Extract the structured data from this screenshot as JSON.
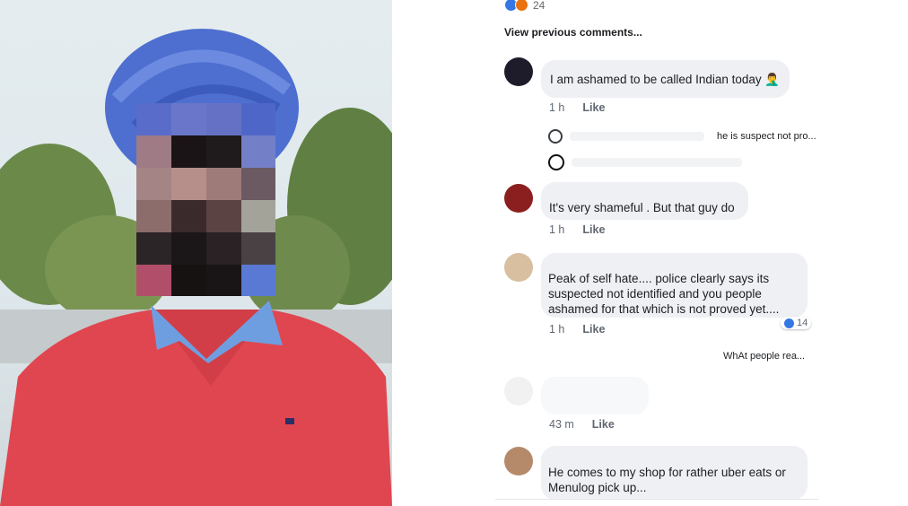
{
  "post": {
    "reaction_count": "24",
    "reaction_icons": [
      "like-icon",
      "angry-icon"
    ],
    "view_previous": "View previous comments..."
  },
  "comments": [
    {
      "text": "I am ashamed to be called Indian today 🤦‍♂️",
      "time": "1 h",
      "like": "Like",
      "replies": [
        {
          "text": "he is suspect not pro..."
        },
        {
          "text": ""
        }
      ]
    },
    {
      "text": "It's very shameful . But that guy do",
      "time": "1 h",
      "like": "Like"
    },
    {
      "text": "Peak of self hate.... police clearly says its suspected not identified and you people ashamed for that which is not proved yet....",
      "time": "1 h",
      "like": "Like",
      "reaction_count": "14",
      "more_replies": "WhAt people rea..."
    },
    {
      "text": "",
      "time": "43 m",
      "like": "Like"
    },
    {
      "text": "He comes to my shop for rather uber eats or Menulog pick up...",
      "time": "",
      "like": ""
    }
  ],
  "colors": {
    "like_blue": "#3578e5",
    "angry_orange": "#e9710f",
    "bubble_bg": "#eef0f3",
    "turban": "#4e6fd0",
    "sweater": "#e0464f"
  }
}
